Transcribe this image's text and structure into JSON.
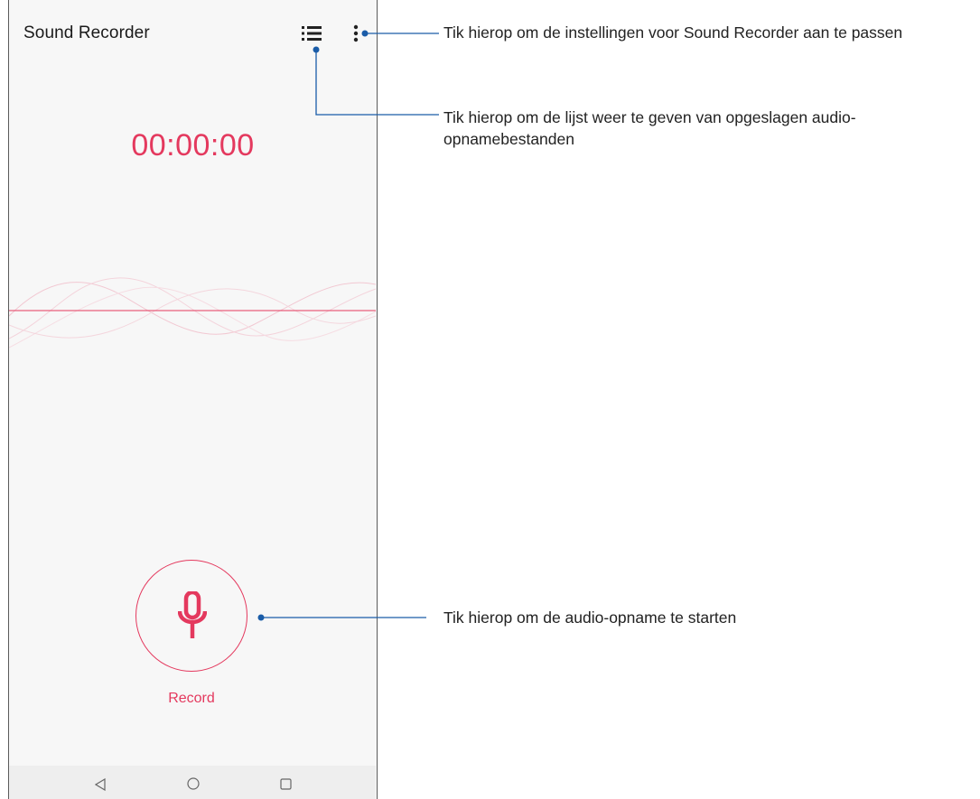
{
  "app": {
    "title": "Sound Recorder",
    "timer": "00:00:00",
    "record_label": "Record"
  },
  "icons": {
    "list": "list-icon",
    "more": "more-vert-icon",
    "mic": "microphone-icon",
    "nav_back": "back-triangle-icon",
    "nav_home": "home-circle-icon",
    "nav_recent": "recent-square-icon"
  },
  "callouts": {
    "settings": "Tik hierop om de instellingen voor Sound Recorder aan te passen",
    "list": "Tik hierop om de lijst weer te geven van opgeslagen audio-opnamebestanden",
    "record": "Tik hierop om de audio-opname te starten"
  },
  "colors": {
    "accent": "#e4395e",
    "callout_line": "#1a5ca8",
    "background": "#f7f7f7",
    "navbar": "#eeeeee"
  }
}
